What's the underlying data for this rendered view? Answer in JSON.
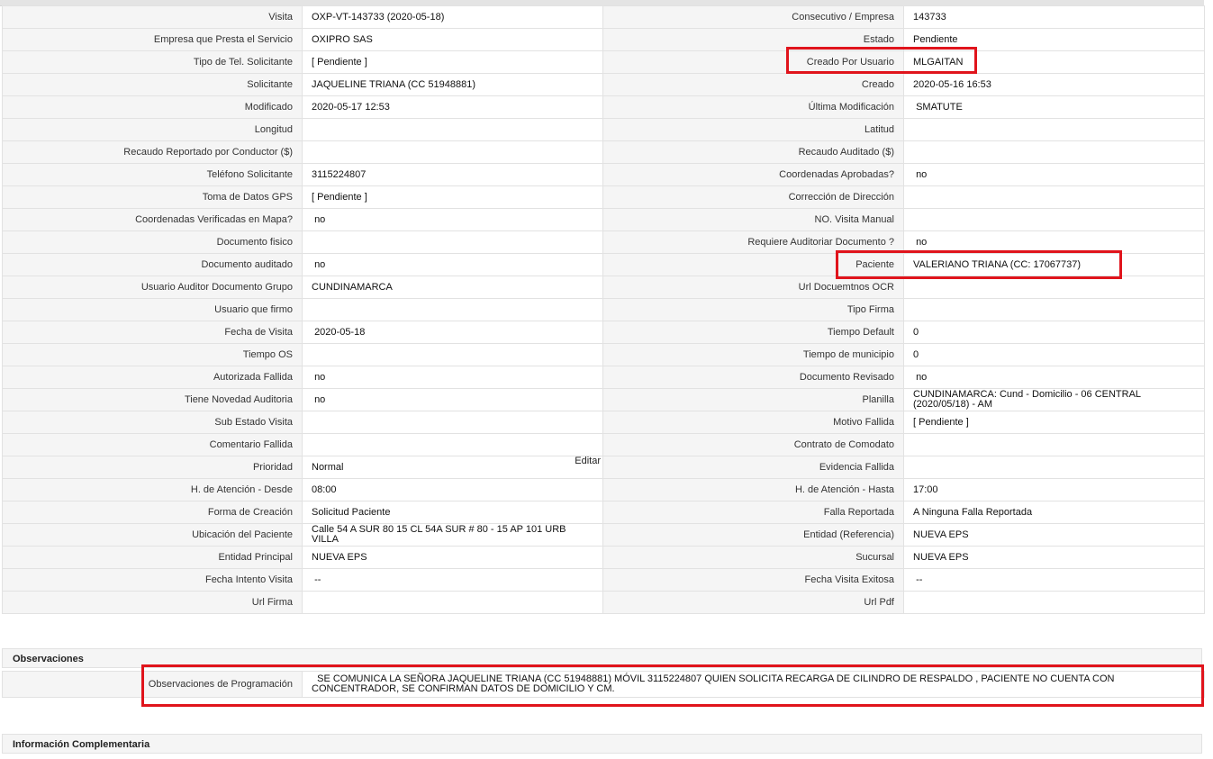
{
  "details": {
    "rows": [
      {
        "l1": "Visita",
        "v1": "OXP-VT-143733 (2020-05-18)",
        "l2": "Consecutivo / Empresa",
        "v2": "143733"
      },
      {
        "l1": "Empresa que Presta el Servicio",
        "v1": "OXIPRO SAS",
        "l2": "Estado",
        "v2": "Pendiente"
      },
      {
        "l1": "Tipo de Tel. Solicitante",
        "v1": "[ Pendiente ]",
        "l2": "Creado Por Usuario",
        "v2": "MLGAITAN"
      },
      {
        "l1": "Solicitante",
        "v1": "JAQUELINE TRIANA (CC 51948881)",
        "l2": "Creado",
        "v2": "2020-05-16 16:53"
      },
      {
        "l1": "Modificado",
        "v1": "2020-05-17 12:53",
        "l2": "Última Modificación",
        "v2": " SMATUTE"
      },
      {
        "l1": "Longitud",
        "v1": "",
        "l2": "Latitud",
        "v2": ""
      },
      {
        "l1": "Recaudo Reportado por Conductor ($)",
        "v1": "",
        "l2": "Recaudo Auditado ($)",
        "v2": ""
      },
      {
        "l1": "Teléfono Solicitante",
        "v1": "3115224807",
        "l2": "Coordenadas Aprobadas?",
        "v2": " no"
      },
      {
        "l1": "Toma de Datos GPS",
        "v1": "[ Pendiente ]",
        "l2": "Corrección de Dirección",
        "v2": ""
      },
      {
        "l1": "Coordenadas Verificadas en Mapa?",
        "v1": " no",
        "l2": "NO. Visita Manual",
        "v2": ""
      },
      {
        "l1": "Documento fisico",
        "v1": "",
        "l2": "Requiere Auditoriar Documento ?",
        "v2": " no"
      },
      {
        "l1": "Documento auditado",
        "v1": " no",
        "l2": "Paciente",
        "v2": "VALERIANO TRIANA (CC: 17067737)"
      },
      {
        "l1": "Usuario Auditor Documento Grupo",
        "v1": "CUNDINAMARCA",
        "l2": "Url Docuemtnos OCR",
        "v2": ""
      },
      {
        "l1": "Usuario que firmo",
        "v1": "",
        "l2": "Tipo Firma",
        "v2": ""
      },
      {
        "l1": "Fecha de Visita",
        "v1": " 2020-05-18",
        "l2": "Tiempo Default",
        "v2": "0"
      },
      {
        "l1": "Tiempo OS",
        "v1": "",
        "l2": "Tiempo de municipio",
        "v2": "0"
      },
      {
        "l1": "Autorizada Fallida",
        "v1": " no",
        "l2": "Documento Revisado",
        "v2": " no"
      },
      {
        "l1": "Tiene Novedad Auditoria",
        "v1": " no",
        "l2": "Planilla",
        "v2": "CUNDINAMARCA: Cund - Domicilio - 06 CENTRAL (2020/05/18) - AM"
      },
      {
        "l1": "Sub Estado Visita",
        "v1": "",
        "l2": "Motivo Fallida",
        "v2": "[ Pendiente ]"
      },
      {
        "l1": "Comentario Fallida",
        "v1": "",
        "l2": "Contrato de Comodato",
        "v2": ""
      },
      {
        "l1": "Prioridad",
        "v1": "Normal",
        "l2": "Evidencia Fallida",
        "v2": ""
      },
      {
        "l1": "H. de Atención - Desde",
        "v1": "08:00",
        "l2": "H. de Atención - Hasta",
        "v2": "17:00"
      },
      {
        "l1": "Forma de Creación",
        "v1": "Solicitud Paciente",
        "l2": "Falla Reportada",
        "v2": "A Ninguna Falla Reportada"
      },
      {
        "l1": "Ubicación del Paciente",
        "v1": "Calle 54 A SUR 80 15 CL 54A SUR # 80 - 15 AP 101 URB VILLA",
        "l2": "Entidad (Referencia)",
        "v2": "NUEVA EPS"
      },
      {
        "l1": "Entidad Principal",
        "v1": "NUEVA EPS",
        "l2": "Sucursal",
        "v2": "NUEVA EPS"
      },
      {
        "l1": "Fecha Intento Visita",
        "v1": " --",
        "l2": "Fecha Visita Exitosa",
        "v2": " --"
      },
      {
        "l1": "Url Firma",
        "v1": "",
        "l2": "Url Pdf",
        "v2": ""
      }
    ],
    "edit_label": "Editar"
  },
  "observaciones": {
    "title": "Observaciones",
    "label": "Observaciones de Programación",
    "text": "  SE COMUNICA LA SEÑORA JAQUELINE TRIANA (CC 51948881) MÓVIL 3115224807 QUIEN SOLICITA RECARGA DE CILINDRO DE RESPALDO , PACIENTE NO CUENTA CON CONCENTRADOR, SE CONFIRMAN DATOS DE DOMICILIO Y CM."
  },
  "info_complementaria": {
    "title": "Información Complementaria"
  },
  "colors": {
    "highlight": "#e0141c",
    "label_bg": "#f5f5f5",
    "border": "#e2e2e2"
  }
}
